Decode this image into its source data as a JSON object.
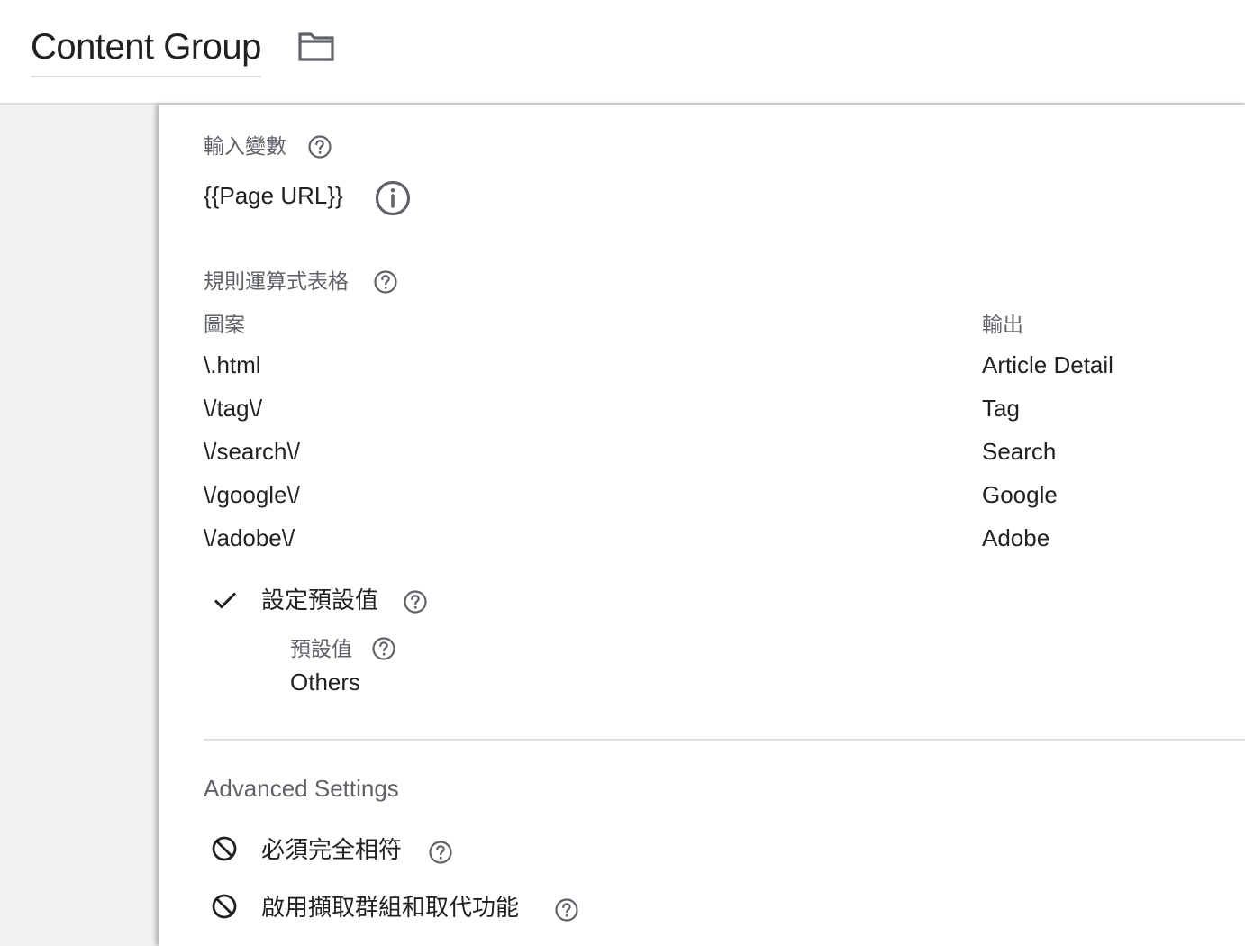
{
  "header": {
    "title": "Content Group",
    "folder_icon": "folder-icon"
  },
  "input_variable": {
    "label": "輸入變數",
    "value": "{{Page URL}}",
    "help_icon": "help-circle-icon",
    "info_icon": "info-circle-icon"
  },
  "lookup_table": {
    "label": "規則運算式表格",
    "help_icon": "help-circle-icon",
    "columns": {
      "pattern": "圖案",
      "output": "輸出"
    },
    "rows": [
      {
        "pattern": "\\.html",
        "output": "Article Detail"
      },
      {
        "pattern": "\\/tag\\/",
        "output": "Tag"
      },
      {
        "pattern": "\\/search\\/",
        "output": "Search"
      },
      {
        "pattern": "\\/google\\/",
        "output": "Google"
      },
      {
        "pattern": "\\/adobe\\/",
        "output": "Adobe"
      }
    ]
  },
  "default_value": {
    "checkbox_label": "設定預設值",
    "checked": true,
    "check_icon": "check-icon",
    "field_label": "預設值",
    "field_value": "Others"
  },
  "advanced": {
    "title": "Advanced Settings",
    "items": [
      {
        "label": "必須完全相符",
        "icon": "block-icon",
        "enabled": false
      },
      {
        "label": "啟用擷取群組和取代功能",
        "icon": "block-icon",
        "enabled": false
      }
    ]
  },
  "colors": {
    "text": "#202124",
    "label": "#5f6368",
    "sidebar_bg": "#f1f1f1",
    "divider": "#e0e0e0"
  }
}
